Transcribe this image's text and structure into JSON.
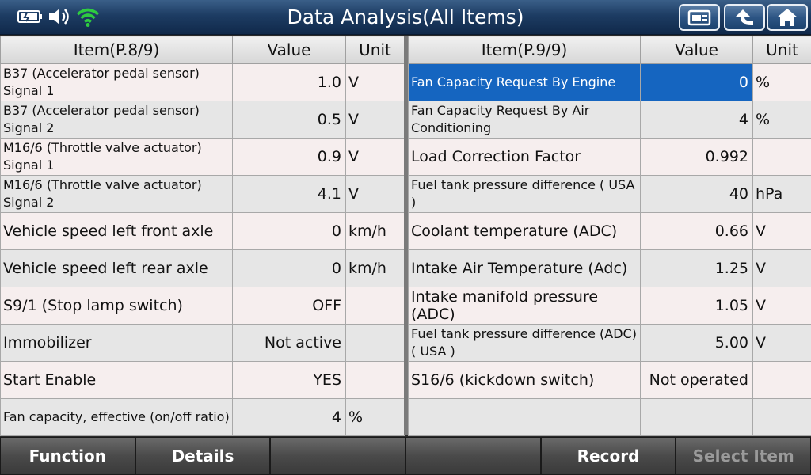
{
  "title": "Data Analysis(All Items)",
  "status": {
    "battery": "battery-icon",
    "volume": "speaker-icon",
    "wifi": "wifi-icon"
  },
  "title_buttons": [
    {
      "name": "screenshot-button",
      "icon": "camera-card-icon"
    },
    {
      "name": "back-button",
      "icon": "back-arrow-icon"
    },
    {
      "name": "home-button",
      "icon": "home-icon"
    }
  ],
  "left": {
    "header": {
      "item": "Item(P.8/9)",
      "value": "Value",
      "unit": "Unit"
    },
    "rows": [
      {
        "line1": "B37 (Accelerator pedal sensor)",
        "line2": "Signal 1",
        "value": "1.0",
        "unit": "V"
      },
      {
        "line1": "B37 (Accelerator pedal sensor)",
        "line2": "Signal 2",
        "value": "0.5",
        "unit": "V"
      },
      {
        "line1": "M16/6 (Throttle valve actuator)",
        "line2": "Signal 1",
        "value": "0.9",
        "unit": "V"
      },
      {
        "line1": "M16/6 (Throttle valve actuator)",
        "line2": "Signal 2",
        "value": "4.1",
        "unit": "V"
      },
      {
        "line1": "Vehicle speed left front axle",
        "line2": "",
        "value": "0",
        "unit": "km/h"
      },
      {
        "line1": "Vehicle speed left rear axle",
        "line2": "",
        "value": "0",
        "unit": "km/h"
      },
      {
        "line1": "S9/1 (Stop lamp switch)",
        "line2": "",
        "value": "OFF",
        "unit": ""
      },
      {
        "line1": "Immobilizer",
        "line2": "",
        "value": "Not active",
        "unit": ""
      },
      {
        "line1": "Start Enable",
        "line2": "",
        "value": "YES",
        "unit": ""
      },
      {
        "line1": "Fan capacity, effective (on/off ratio)",
        "line2": "",
        "value": "4",
        "unit": "%"
      }
    ]
  },
  "right": {
    "header": {
      "item": "Item(P.9/9)",
      "value": "Value",
      "unit": "Unit"
    },
    "rows": [
      {
        "line1": "Fan Capacity Request By Engine",
        "line2": "",
        "value": "0",
        "unit": "%"
      },
      {
        "line1": "Fan Capacity Request By Air",
        "line2": "Conditioning",
        "value": "4",
        "unit": "%"
      },
      {
        "line1": "Load Correction Factor",
        "line2": "",
        "value": "0.992",
        "unit": ""
      },
      {
        "line1": "Fuel tank pressure difference ( USA",
        "line2": ")",
        "value": "40",
        "unit": "hPa"
      },
      {
        "line1": "Coolant temperature (ADC)",
        "line2": "",
        "value": "0.66",
        "unit": "V"
      },
      {
        "line1": "Intake Air Temperature (Adc)",
        "line2": "",
        "value": "1.25",
        "unit": "V"
      },
      {
        "line1": "Intake manifold pressure (ADC)",
        "line2": "",
        "value": "1.05",
        "unit": "V"
      },
      {
        "line1": "Fuel tank pressure difference (ADC)",
        "line2": "( USA )",
        "value": "5.00",
        "unit": "V"
      },
      {
        "line1": "S16/6 (kickdown switch)",
        "line2": "",
        "value": "Not operated",
        "unit": ""
      },
      {
        "line1": "",
        "line2": "",
        "value": "",
        "unit": ""
      }
    ]
  },
  "toolbar": [
    "Function",
    "Details",
    "",
    "",
    "Record",
    "Select Item"
  ],
  "colors": {
    "selected": "#1565c0",
    "title_bar": "#1d3c63",
    "wifi": "#2ecc40"
  }
}
